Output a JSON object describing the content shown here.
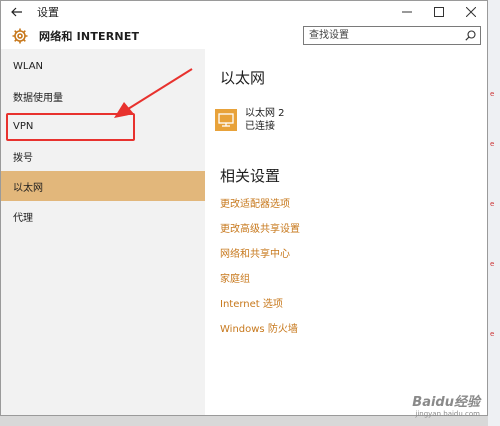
{
  "window": {
    "title": "设置"
  },
  "header": {
    "title": "网络和 INTERNET"
  },
  "search": {
    "placeholder": "查找设置"
  },
  "sidebar": {
    "items": [
      {
        "label": "WLAN"
      },
      {
        "label": "数据使用量"
      },
      {
        "label": "VPN"
      },
      {
        "label": "拨号"
      },
      {
        "label": "以太网"
      },
      {
        "label": "代理"
      }
    ],
    "selected_index": 4
  },
  "main": {
    "section_title": "以太网",
    "network": {
      "name": "以太网 2",
      "status": "已连接"
    },
    "related_title": "相关设置",
    "links": [
      {
        "label": "更改适配器选项"
      },
      {
        "label": "更改高级共享设置"
      },
      {
        "label": "网络和共享中心"
      },
      {
        "label": "家庭组"
      },
      {
        "label": "Internet 选项"
      },
      {
        "label": "Windows 防火墙"
      }
    ]
  },
  "watermark": {
    "brand": "Baidu经验",
    "url": "jingyan.baidu.com"
  },
  "colors": {
    "accent": "#c7781c",
    "selected_bg": "#e2b77b",
    "annotation": "#e8322e",
    "sidebar_bg": "#f2f2f2"
  },
  "icons": {
    "back": "back-arrow-icon",
    "settings": "gear-icon",
    "search": "search-icon",
    "network": "ethernet-icon"
  }
}
